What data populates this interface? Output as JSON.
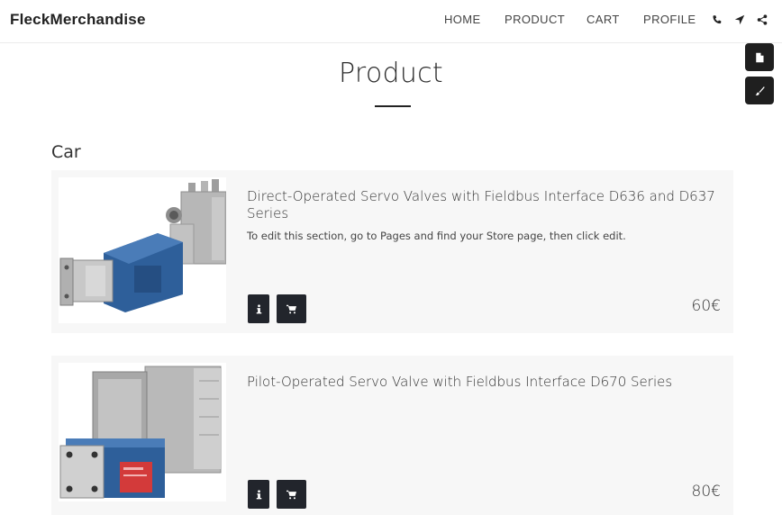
{
  "brand": {
    "name": "FleckMerchandise"
  },
  "nav": {
    "items": [
      "HOME",
      "PRODUCT",
      "CART",
      "PROFILE"
    ]
  },
  "header_icons": [
    "phone-icon",
    "location-arrow-icon",
    "share-icon"
  ],
  "floating_tools": [
    "page-icon",
    "brush-icon"
  ],
  "page": {
    "title": "Product",
    "category": "Car"
  },
  "products": [
    {
      "name": "Direct-Operated Servo Valves with Fieldbus Interface D636 and D637 Series",
      "description": "To edit this section, go to Pages and find your Store page, then click edit.",
      "price": "60€"
    },
    {
      "name": "Pilot-Operated Servo Valve with Fieldbus Interface D670 Series",
      "description": "",
      "price": "80€"
    }
  ],
  "colors": {
    "button_dark": "#22252c",
    "card_bg": "#f7f7f7",
    "valve_blue": "#2e5f9a"
  }
}
